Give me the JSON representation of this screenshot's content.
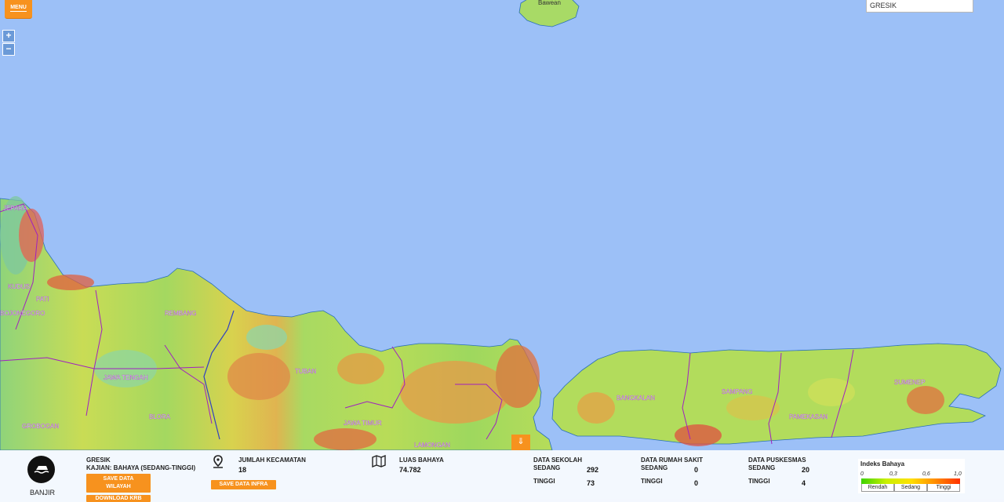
{
  "map": {
    "islands": [
      "Bawean"
    ],
    "region_labels": [
      "JEPARA",
      "PATI",
      "REMBANG",
      "TUBAN",
      "BOJONEGORO",
      "KUDUS",
      "JAWA TENGAH",
      "BLORA",
      "GROBOGAN",
      "JAWA TIMUR",
      "LAMONGAN",
      "BANGKALAN",
      "SAMPANG",
      "PAMEKASAN",
      "SUMENEP"
    ]
  },
  "menu": {
    "label": "MENU"
  },
  "zoom": {
    "in": "+",
    "out": "−"
  },
  "search": {
    "value": "GRESIK"
  },
  "collapse": {
    "icon": "double-chevron-down-icon"
  },
  "panel": {
    "hazard": {
      "name": "BANJIR",
      "icon": "flood-icon"
    },
    "region": {
      "name": "GRESIK",
      "kajian": "KAJIAN: BAHAYA (SEDANG-TINGGI)"
    },
    "buttons": {
      "save_wilayah": "SAVE DATA WILAYAH",
      "download_krb": "DOWNLOAD KRB",
      "save_infra": "SAVE DATA INFRA"
    },
    "kecamatan": {
      "label": "JUMLAH KECAMATAN",
      "value": "18"
    },
    "luas": {
      "label": "LUAS BAHAYA",
      "value": "74.782"
    },
    "sekolah": {
      "label": "DATA SEKOLAH",
      "sedang_label": "SEDANG",
      "sedang": "292",
      "tinggi_label": "TINGGI",
      "tinggi": "73"
    },
    "rumah_sakit": {
      "label": "DATA RUMAH SAKIT",
      "sedang_label": "SEDANG",
      "sedang": "0",
      "tinggi_label": "TINGGI",
      "tinggi": "0"
    },
    "puskesmas": {
      "label": "DATA PUSKESMAS",
      "sedang_label": "SEDANG",
      "sedang": "20",
      "tinggi_label": "TINGGI",
      "tinggi": "4"
    }
  },
  "legend": {
    "title": "Indeks Bahaya",
    "ticks": [
      "0",
      "0,3",
      "0,6",
      "1,0"
    ],
    "categories": [
      "Rendah",
      "Sedang",
      "Tinggi"
    ],
    "colors": {
      "low": "#3cd200",
      "mid": "#ffe000",
      "high": "#ff3000"
    }
  },
  "colors": {
    "accent": "#f7921e",
    "sea": "#9cc0f7"
  }
}
